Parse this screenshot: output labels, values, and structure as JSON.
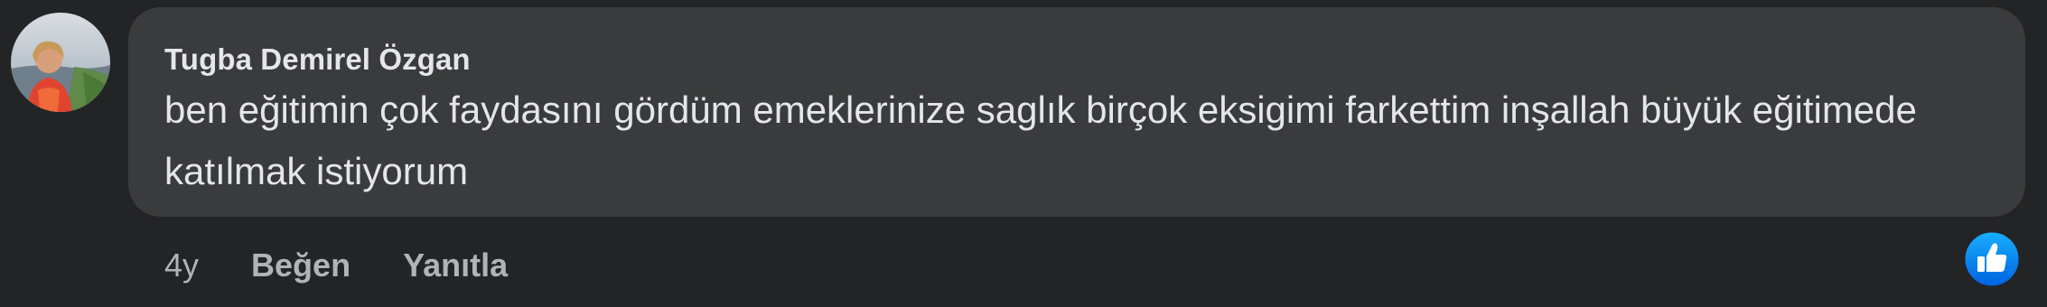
{
  "comment": {
    "author": "Tugba Demirel Özgan",
    "text": "ben eğitimin çok faydasını gördüm emeklerinize saglık birçok eksigimi farkettim inşallah büyük eğitimede katılmak istiyorum",
    "timestamp": "4y",
    "like_label": "Beğen",
    "reply_label": "Yanıtla",
    "reaction_icon": "thumbs-up-icon",
    "colors": {
      "background": "#232426",
      "bubble": "#3a3b3c",
      "text": "#e4e6eb",
      "secondary_text": "#b0b3b8",
      "reaction": "#1877f2"
    }
  }
}
